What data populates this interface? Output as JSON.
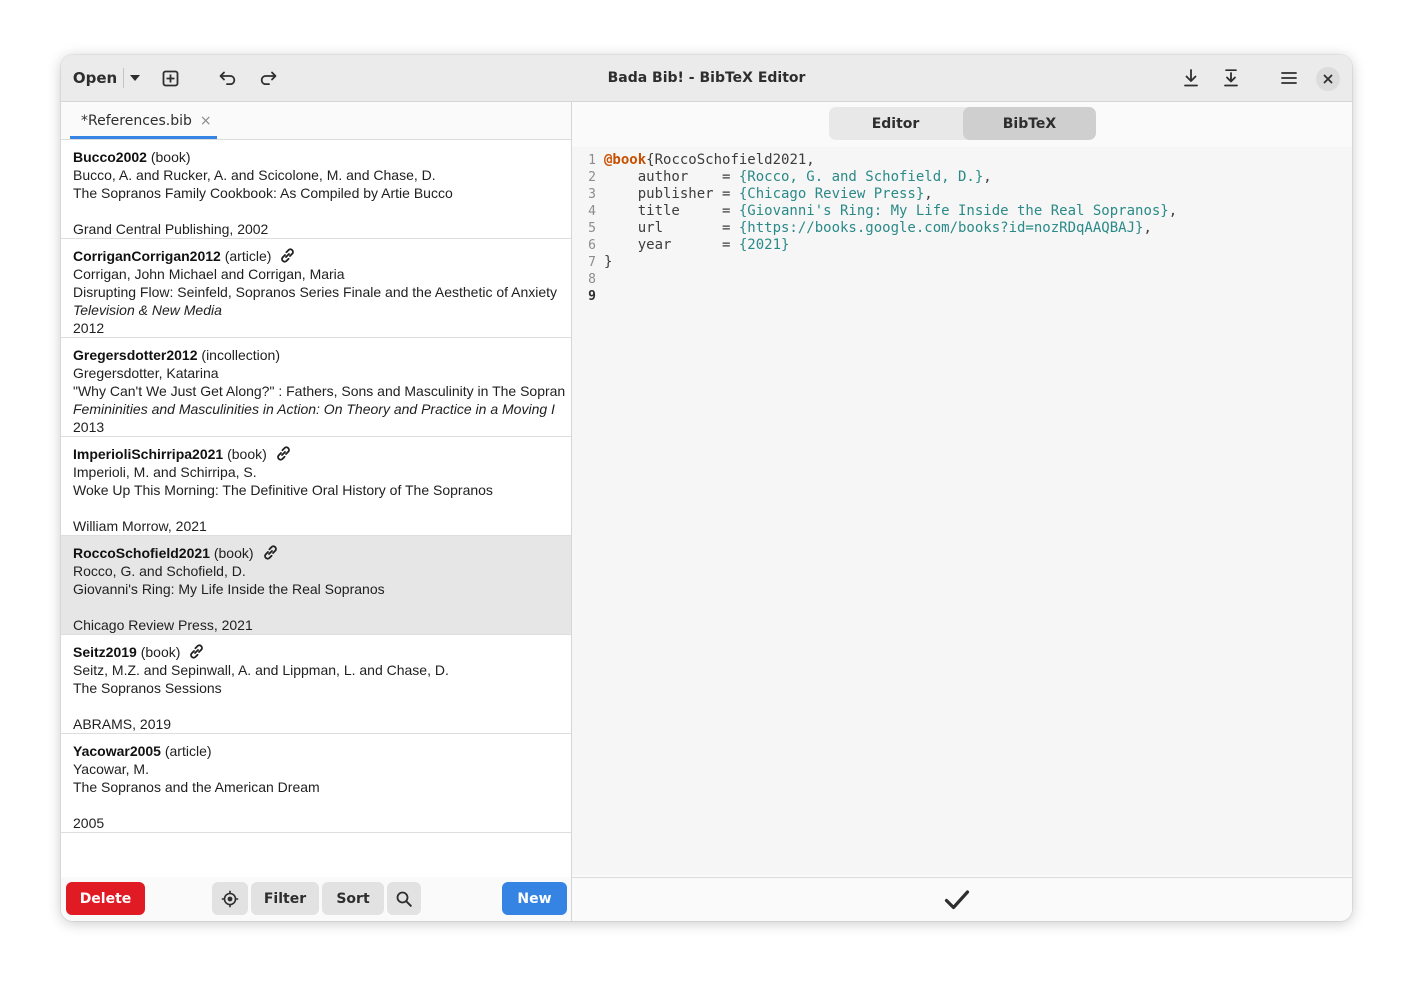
{
  "window": {
    "title": "Bada Bib! - BibTeX Editor"
  },
  "headerbar": {
    "open_label": "Open",
    "icons": [
      "chevron-down-icon",
      "new-tab-icon",
      "undo-icon",
      "redo-icon",
      "save-icon",
      "save-as-icon",
      "menu-icon",
      "close-icon"
    ]
  },
  "tab": {
    "label": "*References.bib",
    "close": "×"
  },
  "entries": [
    {
      "key": "Bucco2002",
      "type": "(book)",
      "has_link": false,
      "author": "Bucco, A. and Rucker, A. and Scicolone, M. and Chase, D.",
      "title": "The Sopranos Family Cookbook: As Compiled by Artie Bucco",
      "container": "",
      "publication": "Grand Central Publishing, 2002",
      "selected": false
    },
    {
      "key": "CorriganCorrigan2012",
      "type": "(article)",
      "has_link": true,
      "author": "Corrigan, John Michael and Corrigan, Maria",
      "title": "Disrupting Flow: Seinfeld, Sopranos Series Finale and the Aesthetic of Anxiety",
      "container": "Television & New Media",
      "publication": "2012",
      "selected": false
    },
    {
      "key": "Gregersdotter2012",
      "type": "(incollection)",
      "has_link": false,
      "author": "Gregersdotter, Katarina",
      "title": "\"Why Can't We Just Get Along?\" : Fathers, Sons and Masculinity in The Sopran",
      "container": "Femininities and Masculinities in Action: On Theory and Practice in a Moving I",
      "publication": "2013",
      "selected": false
    },
    {
      "key": "ImperioliSchirripa2021",
      "type": "(book)",
      "has_link": true,
      "author": "Imperioli, M. and Schirripa, S.",
      "title": "Woke Up This Morning: The Definitive Oral History of The Sopranos",
      "container": "",
      "publication": "William Morrow, 2021",
      "selected": false
    },
    {
      "key": "RoccoSchofield2021",
      "type": "(book)",
      "has_link": true,
      "author": "Rocco, G. and Schofield, D.",
      "title": "Giovanni's Ring: My Life Inside the Real Sopranos",
      "container": "",
      "publication": "Chicago Review Press, 2021",
      "selected": true
    },
    {
      "key": "Seitz2019",
      "type": "(book)",
      "has_link": true,
      "author": "Seitz, M.Z. and Sepinwall, A. and Lippman, L. and Chase, D.",
      "title": "The Sopranos Sessions",
      "container": "",
      "publication": "ABRAMS, 2019",
      "selected": false
    },
    {
      "key": "Yacowar2005",
      "type": "(article)",
      "has_link": false,
      "author": "Yacowar, M.",
      "title": "The Sopranos and the American Dream",
      "container": "",
      "publication": "2005",
      "selected": false
    }
  ],
  "sidebar_footer": {
    "delete_label": "Delete",
    "filter_label": "Filter",
    "sort_label": "Sort",
    "new_label": "New"
  },
  "switcher": {
    "editor_label": "Editor",
    "bibtex_label": "BibTeX",
    "active": "BibTeX"
  },
  "code": {
    "line_numbers": [
      "1",
      "2",
      "3",
      "4",
      "5",
      "6",
      "7",
      "8",
      "9"
    ],
    "current_line": "9",
    "lines": [
      {
        "kw": "@book",
        "rest": "{RoccoSchofield2021,",
        "field": "",
        "value": "",
        "tail": ""
      },
      {
        "kw": "",
        "rest": "",
        "field": "    author    = ",
        "value": "{Rocco, G. and Schofield, D.}",
        "tail": ","
      },
      {
        "kw": "",
        "rest": "",
        "field": "    publisher = ",
        "value": "{Chicago Review Press}",
        "tail": ","
      },
      {
        "kw": "",
        "rest": "",
        "field": "    title     = ",
        "value": "{Giovanni's Ring: My Life Inside the Real Sopranos}",
        "tail": ","
      },
      {
        "kw": "",
        "rest": "",
        "field": "    url       = ",
        "value": "{https://books.google.com/books?id=nozRDqAAQBAJ}",
        "tail": ","
      },
      {
        "kw": "",
        "rest": "",
        "field": "    year      = ",
        "value": "{2021}",
        "tail": ""
      },
      {
        "kw": "",
        "rest": "}",
        "field": "",
        "value": "",
        "tail": ""
      },
      {
        "kw": "",
        "rest": "",
        "field": "",
        "value": "",
        "tail": ""
      },
      {
        "kw": "",
        "rest": "",
        "field": "",
        "value": "",
        "tail": ""
      }
    ]
  },
  "colors": {
    "accent": "#3584e4",
    "destructive": "#e01b24",
    "keyword": "#c75000",
    "string": "#2a8a88"
  }
}
